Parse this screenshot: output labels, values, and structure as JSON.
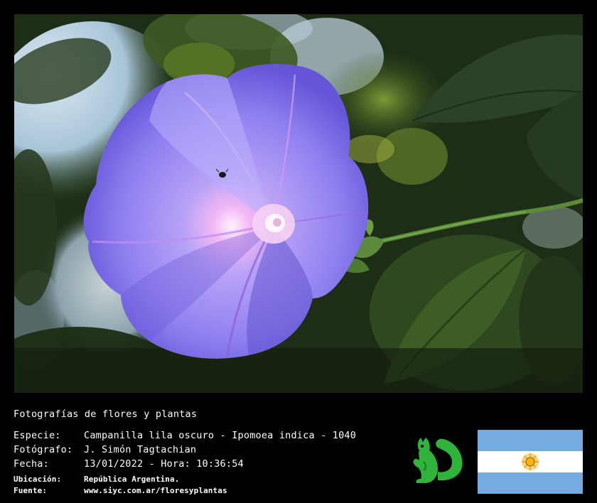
{
  "caption": {
    "title": "Fotografías de flores y plantas"
  },
  "details": {
    "species_label": "Especie:",
    "species_value": "Campanilla lila oscuro - Ipomoea indica - 1040",
    "photographer_label": "Fotógrafo:",
    "photographer_value": "J. Simón Tagtachian",
    "date_label": "Fecha:",
    "date_value": "13/01/2022 - Hora: 10:36:54",
    "location_label": "Ubicación:",
    "location_value": "República Argentina.",
    "source_label": "Fuente:",
    "source_value": "www.siyc.com.ar/floresyplantas"
  },
  "colors": {
    "background": "#000000",
    "text": "#ffffff",
    "flower": "#7a6cf0",
    "mascot": "#2fb33a",
    "flag_blue": "#74acdf",
    "flag_sun": "#f6b40e"
  },
  "icons": {
    "mascot": "green-squirrel-logo",
    "flag": "argentina-flag"
  }
}
